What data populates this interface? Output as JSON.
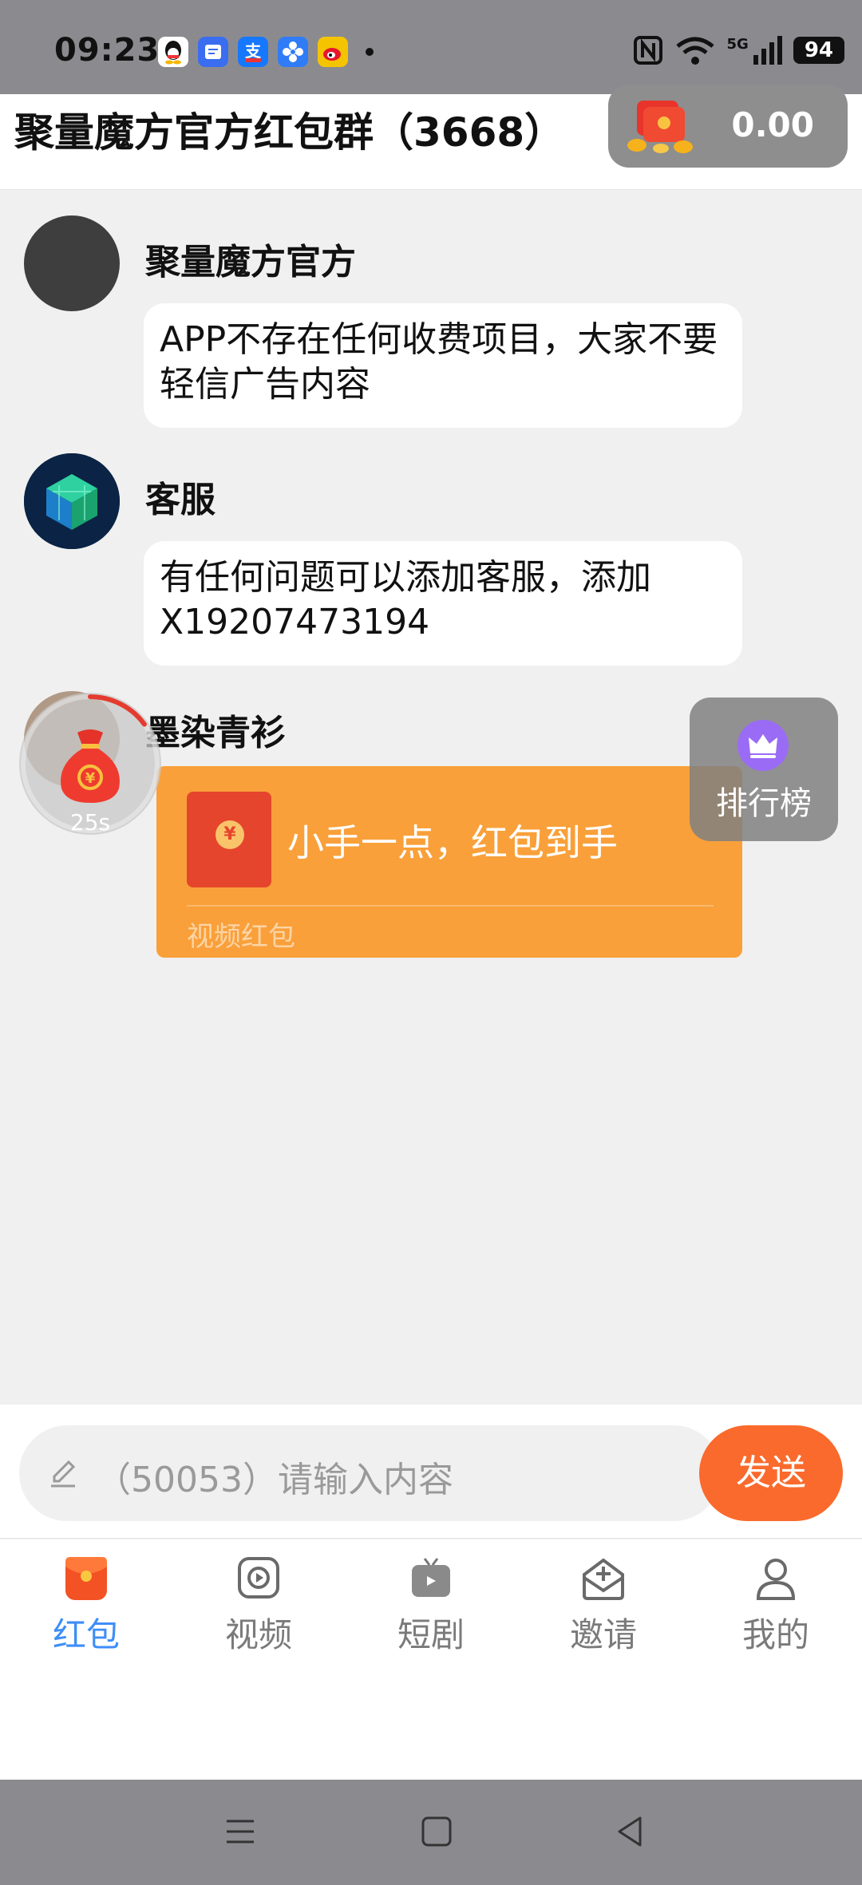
{
  "status_bar": {
    "time": "09:23",
    "network": "5G",
    "battery": "94",
    "app_icons": [
      "qq-icon",
      "mail-icon",
      "alipay-icon",
      "pinwheel-icon",
      "weibo-icon"
    ]
  },
  "header": {
    "title": "聚量魔方官方红包群（3668）",
    "balance": "0.00"
  },
  "messages": [
    {
      "sender": "聚量魔方官方",
      "text": "APP不存在任何收费项目，大家不要轻信广告内容"
    },
    {
      "sender": "客服",
      "text": "有任何问题可以添加客服，添加X19207473194"
    }
  ],
  "red_packet": {
    "sender": "墨染青衫",
    "coin_symbol": "¥",
    "text": "小手一点，红包到手",
    "type": "视频红包"
  },
  "timer": {
    "seconds": "25s",
    "progress": 0.15
  },
  "ranking": {
    "label": "排行榜"
  },
  "input": {
    "placeholder": "（50053）请输入内容",
    "send_label": "发送"
  },
  "tabs": [
    {
      "label": "红包",
      "icon": "red-packet-icon",
      "active": true
    },
    {
      "label": "视频",
      "icon": "video-icon",
      "active": false
    },
    {
      "label": "短剧",
      "icon": "tv-icon",
      "active": false
    },
    {
      "label": "邀请",
      "icon": "invite-icon",
      "active": false
    },
    {
      "label": "我的",
      "icon": "profile-icon",
      "active": false
    }
  ],
  "colors": {
    "accent_orange": "#fa6a2d",
    "packet_orange": "#f9a03a",
    "tab_active": "#3e8ef7"
  }
}
